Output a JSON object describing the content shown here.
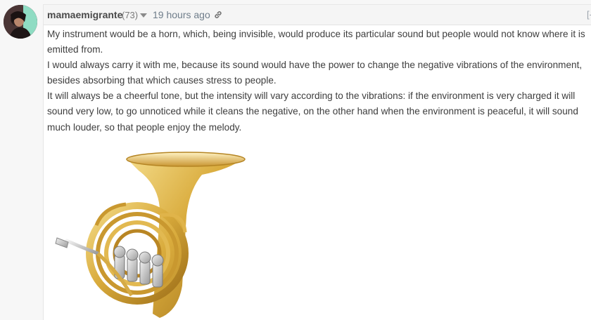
{
  "comment": {
    "author": "mamaemigrante",
    "reputation": "(73)",
    "timestamp": "19 hours ago",
    "collapse_label": "[-",
    "paragraphs": [
      "My instrument would be a horn, which, being invisible, would produce its particular sound but people would not know where it is emitted from.",
      "I would always carry it with me, because its sound would have the power to change the negative vibrations of the environment, besides absorbing that which causes stress to people.",
      "It will always be a cheerful tone, but the intensity will vary according to the vibrations: if the environment is very charged it will sound very low, to go unnoticed while it cleans the negative, on the other hand when the environment is peaceful, it will sound much louder, so that people enjoy the melody."
    ],
    "image_subject": "french-horn",
    "icons": {
      "caret": "caret-down-icon",
      "link": "link-icon"
    },
    "colors": {
      "header_bg": "#f5f5f5",
      "text": "#3d3d3d",
      "timestamp": "#6f7d8a",
      "brass": "#d4a73a"
    }
  }
}
